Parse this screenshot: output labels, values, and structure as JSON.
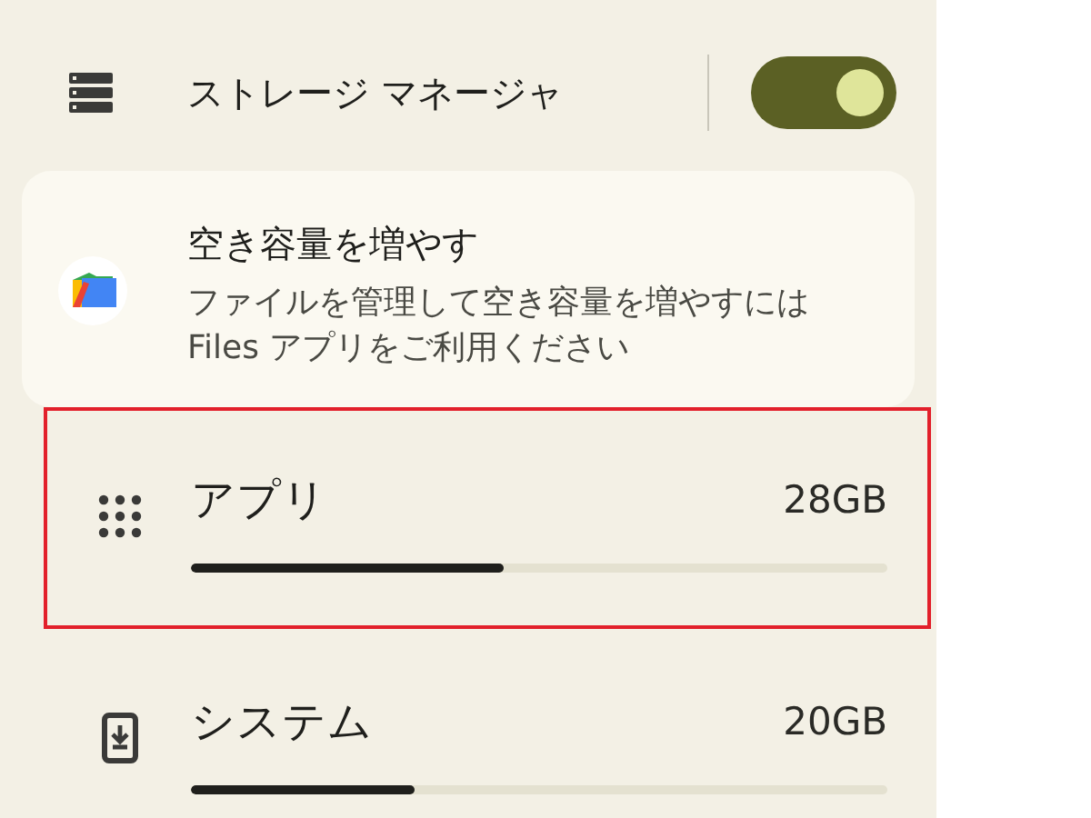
{
  "storage_manager": {
    "label": "ストレージ マネージャ",
    "on": true
  },
  "tip_card": {
    "title": "空き容量を増やす",
    "description": "ファイルを管理して空き容量を増やすには Files アプリをご利用ください"
  },
  "categories": [
    {
      "kind": "apps",
      "name": "アプリ",
      "size": "28GB",
      "level": 0.45,
      "highlighted": true
    },
    {
      "kind": "system",
      "name": "システム",
      "size": "20GB",
      "level": 0.32,
      "highlighted": false
    }
  ]
}
